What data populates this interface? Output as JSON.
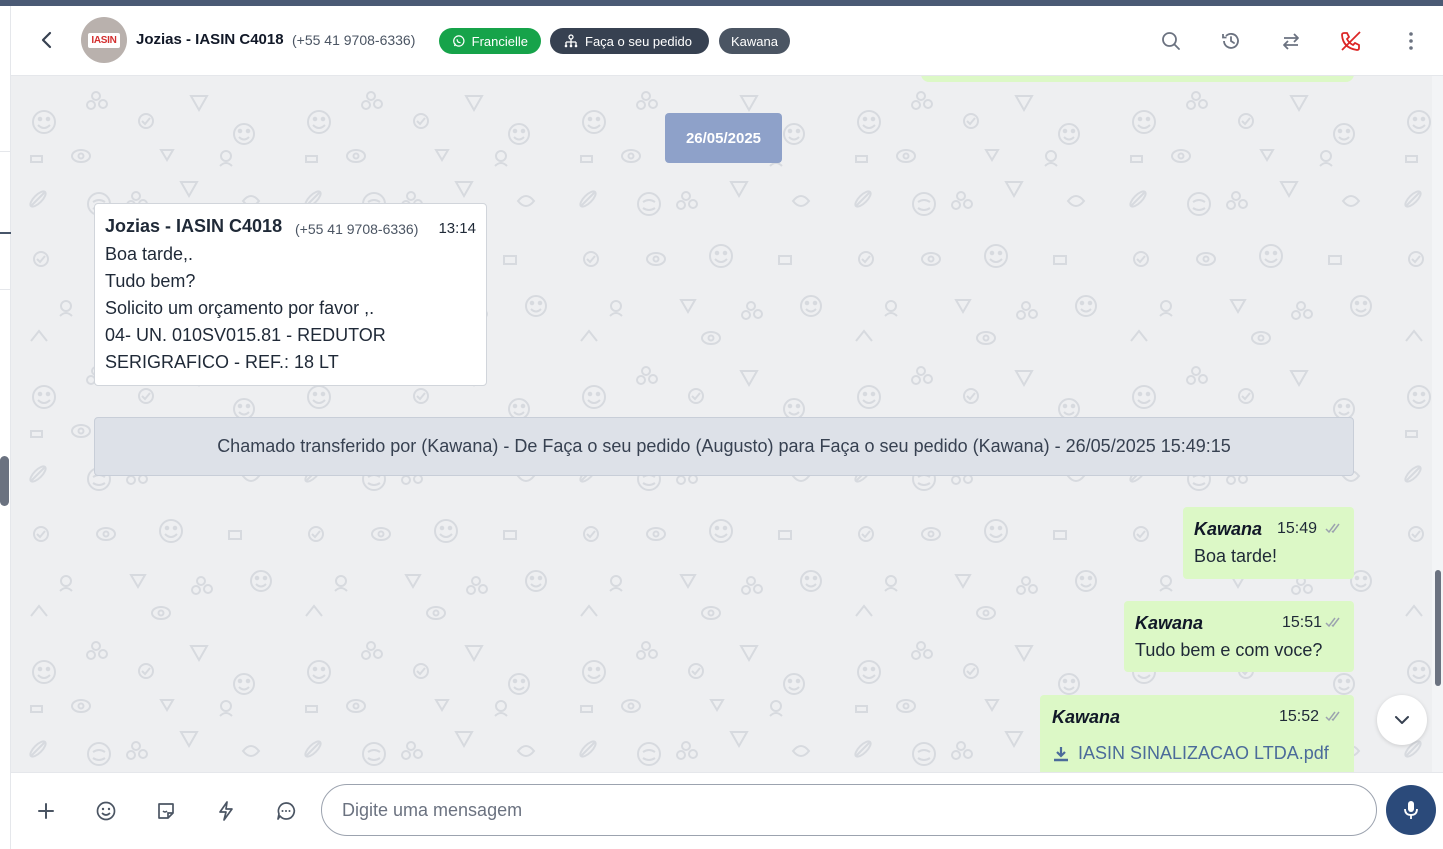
{
  "header": {
    "contact_name": "Jozias - IASIN C4018",
    "contact_phone": "(+55 41 9708-6336)",
    "avatar_text": "IASIN",
    "badges": [
      {
        "label": "Francielle",
        "icon": "whatsapp-icon",
        "color": "#16a34a"
      },
      {
        "label": "Faça o seu pedido",
        "icon": "sitemap-icon",
        "color": "#374151"
      },
      {
        "label": "Kawana",
        "color": "#4b5563"
      }
    ],
    "actions": [
      "search-icon",
      "history-icon",
      "transfer-icon",
      "end-call-icon",
      "more-vertical-icon"
    ]
  },
  "chat": {
    "date": "26/05/2025",
    "incoming": {
      "sender": "Jozias - IASIN C4018",
      "phone": "(+55 41 9708-6336)",
      "time": "13:14",
      "lines": [
        "Boa tarde,.",
        "Tudo bem?",
        "Solicito um orçamento por favor ,.",
        "04- UN. 010SV015.81 - REDUTOR",
        "SERIGRAFICO - REF.: 18 LT"
      ]
    },
    "system_message": "Chamado transferido por (Kawana) - De Faça o seu pedido (Augusto) para Faça o seu pedido (Kawana) - 26/05/2025 15:49:15",
    "outgoing": [
      {
        "sender": "Kawana",
        "time": "15:49",
        "text": "Boa tarde!"
      },
      {
        "sender": "Kawana",
        "time": "15:51",
        "text": "Tudo bem e com voce?"
      },
      {
        "sender": "Kawana",
        "time": "15:52",
        "file": "IASIN SINALIZACAO LTDA.pdf"
      }
    ],
    "bubble_color": "#dcf8c6"
  },
  "composer": {
    "placeholder": "Digite uma mensagem",
    "value": "",
    "icons": [
      "plus-icon",
      "emoji-icon",
      "sticker-icon",
      "quick-reply-icon",
      "chat-icon",
      "microphone-icon"
    ]
  }
}
